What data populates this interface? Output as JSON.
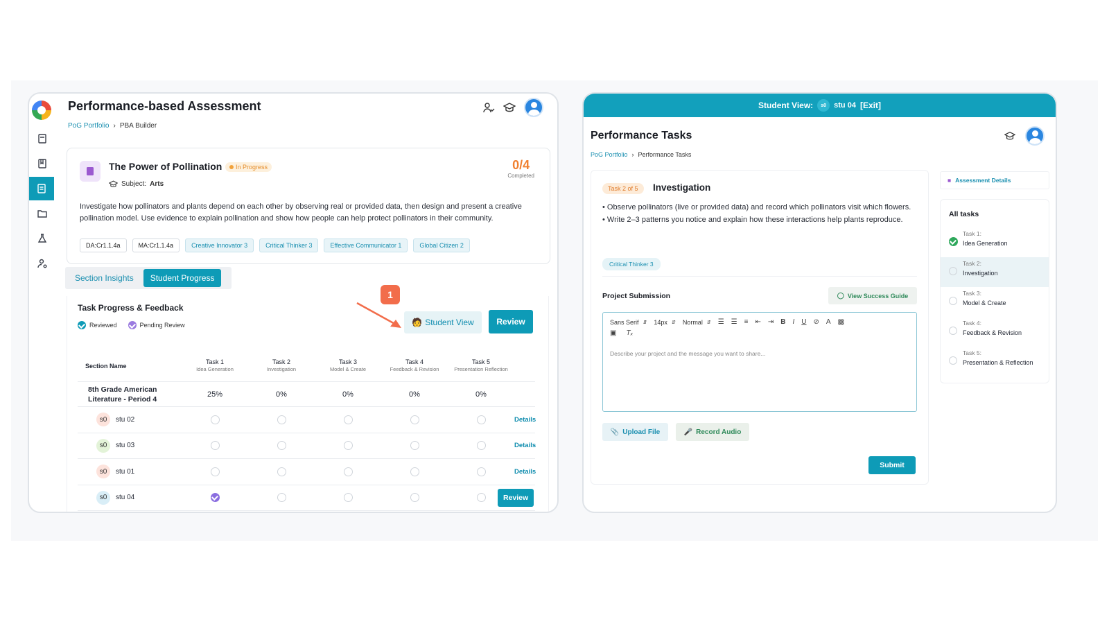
{
  "left": {
    "title": "Performance-based Assessment",
    "breadcrumb": {
      "root": "PoG Portfolio",
      "sep": "›",
      "current": "PBA Builder"
    },
    "assessment": {
      "title": "The Power of Pollination",
      "status": "In Progress",
      "subject_label": "Subject:",
      "subject": "Arts",
      "score": "0/4",
      "score_label": "Completed",
      "description": "Investigate how pollinators and plants depend on each other by observing real or provided data, then design and present a creative pollination model. Use evidence to explain pollination and show how people can help protect pollinators in their community.",
      "tags": [
        "DA:Cr1.1.4a",
        "MA:Cr1.1.4a",
        "Creative Innovator 3",
        "Critical Thinker 3",
        "Effective Communicator 1",
        "Global Citizen 2"
      ]
    },
    "tabs": [
      "Section Insights",
      "Student Progress"
    ],
    "progress": {
      "title": "Task Progress & Feedback",
      "legend": [
        "Reviewed",
        "Pending Review"
      ],
      "student_view_label": "Student View",
      "review_label": "Review",
      "callout": "1",
      "col_section": "Section Name",
      "tasks": [
        {
          "name": "Task 1",
          "sub": "Idea Generation"
        },
        {
          "name": "Task 2",
          "sub": "Investigation"
        },
        {
          "name": "Task 3",
          "sub": "Model & Create"
        },
        {
          "name": "Task 4",
          "sub": "Feedback & Revision"
        },
        {
          "name": "Task 5",
          "sub": "Presentation Reflection"
        }
      ],
      "section": {
        "name": "8th Grade American Literature - Period 4",
        "values": [
          "25%",
          "0%",
          "0%",
          "0%",
          "0%"
        ]
      },
      "students": [
        {
          "initials": "s0",
          "name": "stu 02",
          "action": "Details",
          "color": "#fde3dc"
        },
        {
          "initials": "s0",
          "name": "stu 03",
          "action": "Details",
          "color": "#e3f3d8"
        },
        {
          "initials": "s0",
          "name": "stu 01",
          "action": "Details",
          "color": "#fde3dc"
        },
        {
          "initials": "s0",
          "name": "stu 04",
          "action": "Review",
          "color": "#d9eef7"
        }
      ]
    }
  },
  "right": {
    "banner": {
      "label": "Student View:",
      "chip": "s0",
      "name": "stu 04",
      "exit": "[Exit]"
    },
    "title": "Performance Tasks",
    "breadcrumb": {
      "root": "PoG Portfolio",
      "sep": "›",
      "current": "Performance Tasks"
    },
    "task": {
      "badge": "Task 2 of 5",
      "title": "Investigation",
      "bullet1": "• Observe pollinators (live or provided data) and record which pollinators visit which flowers.",
      "bullet2": "• Write 2–3 patterns you notice and explain how these interactions help plants reproduce.",
      "tag": "Critical Thinker 3",
      "submission_label": "Project Submission",
      "guide_label": "View Success Guide",
      "editor": {
        "font": "Sans Serif",
        "size": "14px",
        "style": "Normal",
        "placeholder": "Describe your project and the message you want to share..."
      },
      "upload_label": "Upload File",
      "record_label": "Record Audio",
      "submit_label": "Submit"
    },
    "assessment_details_label": "Assessment Details",
    "all_tasks_title": "All tasks",
    "task_list": [
      {
        "num": "Task 1:",
        "name": "Idea Generation"
      },
      {
        "num": "Task 2:",
        "name": "Investigation"
      },
      {
        "num": "Task 3:",
        "name": "Model & Create"
      },
      {
        "num": "Task 4:",
        "name": "Feedback & Revision"
      },
      {
        "num": "Task 5:",
        "name": "Presentation & Reflection"
      }
    ]
  }
}
